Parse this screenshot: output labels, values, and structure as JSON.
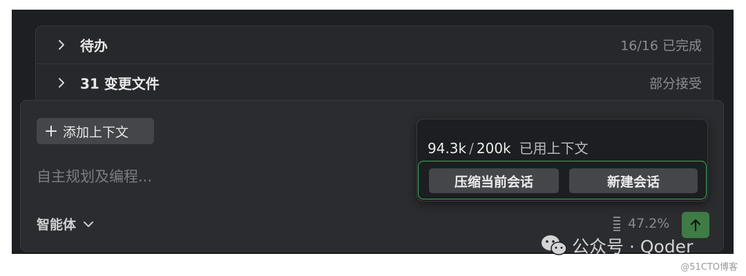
{
  "todo_row": {
    "title": "待办",
    "status": "16/16 已完成"
  },
  "files_row": {
    "title": "31 变更文件",
    "status": "部分接受"
  },
  "input": {
    "add_context_label": "添加上下文",
    "placeholder": "自主规划及编程...",
    "agent_label": "智能体",
    "usage_percent": "47.2%"
  },
  "context_popup": {
    "used": "94.3k",
    "separator": "/",
    "total": "200k",
    "label": "已用上下文",
    "compress_label": "压缩当前会话",
    "new_session_label": "新建会话"
  },
  "watermark": {
    "text": "公众号 · Qoder",
    "credit": "@51CTO博客"
  },
  "colors": {
    "accent_green": "#3cae55",
    "send_button": "#3f7c45",
    "panel_bg": "#2b2c2f"
  },
  "icons": [
    "chevron-right-icon",
    "plus-icon",
    "chevron-down-icon",
    "context-usage-icon",
    "arrow-up-icon",
    "wechat-icon"
  ]
}
